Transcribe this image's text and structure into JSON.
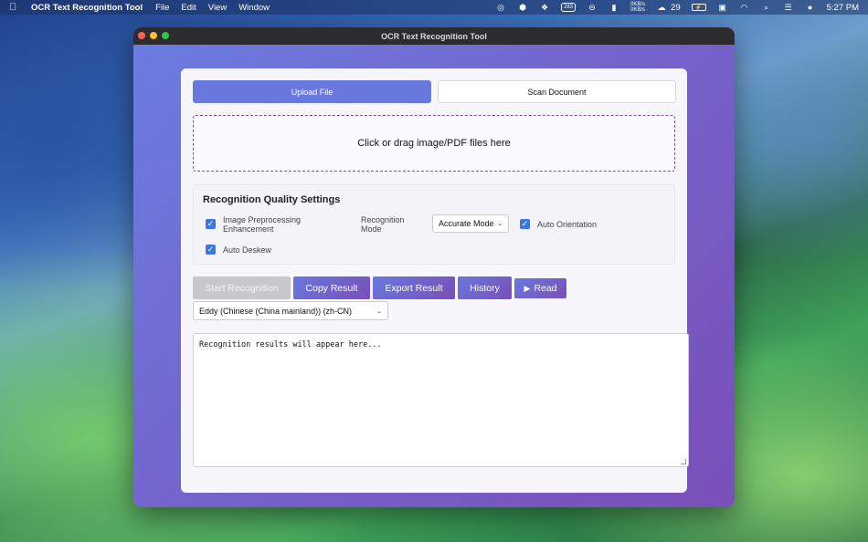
{
  "menubar": {
    "app_name": "OCR Text Recognition Tool",
    "menus": [
      "File",
      "Edit",
      "View",
      "Window"
    ],
    "net_up": "0KB/s",
    "net_down": "0KB/s",
    "wechat_count": "29",
    "calendar_badge": "283",
    "time": "5:27 PM"
  },
  "window": {
    "title": "OCR Text Recognition Tool"
  },
  "tabs": {
    "upload": "Upload File",
    "scan": "Scan Document"
  },
  "dropzone": {
    "text": "Click or drag image/PDF files here"
  },
  "settings": {
    "title": "Recognition Quality Settings",
    "preprocess_label_1": "Image Preprocessing",
    "preprocess_label_2": "Enhancement",
    "preprocess_checked": true,
    "mode_label_1": "Recognition",
    "mode_label_2": "Mode",
    "mode_value": "Accurate Mode",
    "orientation_label": "Auto Orientation",
    "orientation_checked": true,
    "deskew_label": "Auto Deskew",
    "deskew_checked": true
  },
  "actions": {
    "start": "Start Recognition",
    "copy": "Copy Result",
    "export": "Export Result",
    "history": "History",
    "read": "Read"
  },
  "voice": {
    "selected": "Eddy (Chinese (China mainland)) (zh-CN)"
  },
  "result": {
    "placeholder": "Recognition results will appear here..."
  }
}
